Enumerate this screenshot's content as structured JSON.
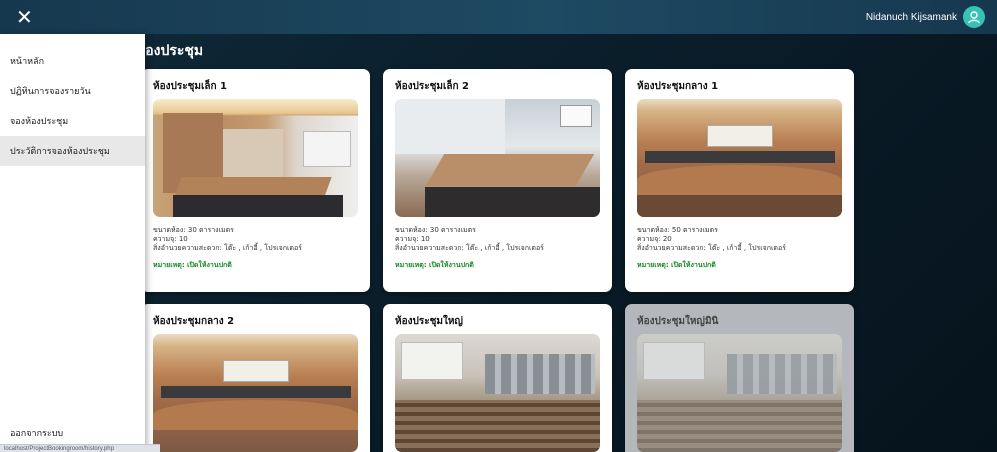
{
  "header": {
    "close_label": "✕",
    "user_name": "Nidanuch Kijsamank"
  },
  "page_title": "ห้องประชุม",
  "sidebar": {
    "items": [
      {
        "label": "หน้าหลัก",
        "active": false
      },
      {
        "label": "ปฏิทินการจองรายวัน",
        "active": false
      },
      {
        "label": "จองห้องประชุม",
        "active": false
      },
      {
        "label": "ประวัติการจองห้องประชุม",
        "active": true
      }
    ],
    "logout_label": "ออกจากระบบ"
  },
  "status_url": "localhost/ProjectBookingroom/history.php",
  "rooms": [
    {
      "title": "ห้องประชุมเล็ก 1",
      "size": "ขนาดห้อง: 30 ตารางเมตร",
      "capacity": "ความจุ: 10",
      "facilities": "สิ่งอำนวยความสะดวก: โต๊ะ , เก้าอี้ , โปรเจกเตอร์",
      "note": "หมายเหตุ: เปิดให้งานปกติ",
      "available": true
    },
    {
      "title": "ห้องประชุมเล็ก 2",
      "size": "ขนาดห้อง: 30 ตารางเมตร",
      "capacity": "ความจุ: 10",
      "facilities": "สิ่งอำนวยความสะดวก: โต๊ะ , เก้าอี้ , โปรเจกเตอร์",
      "note": "หมายเหตุ: เปิดให้งานปกติ",
      "available": true
    },
    {
      "title": "ห้องประชุมกลาง 1",
      "size": "ขนาดห้อง: 50 ตารางเมตร",
      "capacity": "ความจุ: 20",
      "facilities": "สิ่งอำนวยความสะดวก: โต๊ะ , เก้าอี้ , โปรเจกเตอร์",
      "note": "หมายเหตุ: เปิดให้งานปกติ",
      "available": true
    },
    {
      "title": "ห้องประชุมกลาง 2",
      "available": true
    },
    {
      "title": "ห้องประชุมใหญ่",
      "available": true
    },
    {
      "title": "ห้องประชุมใหญ่มินิ",
      "available": false
    }
  ],
  "colors": {
    "header_bg": "#1e4a63",
    "avatar": "#36c3b5",
    "note_green": "#1a8a2a",
    "disabled_card": "#b4b8bc"
  }
}
